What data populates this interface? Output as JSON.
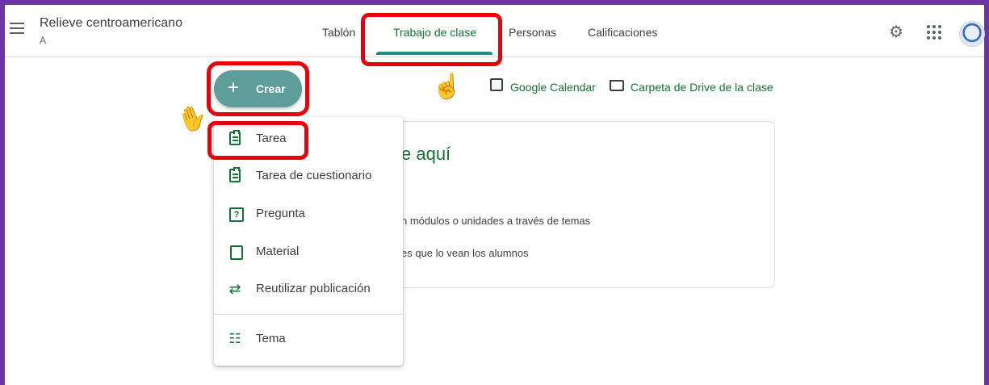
{
  "header": {
    "class_title": "Relieve centroamericano",
    "class_section": "A",
    "tabs": [
      {
        "label": "Tablón"
      },
      {
        "label": "Trabajo de clase"
      },
      {
        "label": "Personas"
      },
      {
        "label": "Calificaciones"
      }
    ]
  },
  "toolbar": {
    "create_label": "Crear",
    "create_icon": "+",
    "calendar_link": "Google Calendar",
    "drive_link": "Carpeta de Drive de la clase"
  },
  "card": {
    "title": "e aquí",
    "line1": "n módulos o unidades a través de temas",
    "line2": "es que lo vean los alumnos"
  },
  "create_menu": {
    "items": [
      {
        "label": "Tarea",
        "icon": "assignment-icon"
      },
      {
        "label": "Tarea de cuestionario",
        "icon": "quiz-assignment-icon"
      },
      {
        "label": "Pregunta",
        "icon": "question-icon"
      },
      {
        "label": "Material",
        "icon": "material-icon"
      },
      {
        "label": "Reutilizar publicación",
        "icon": "reuse-icon"
      },
      {
        "label": "Tema",
        "icon": "topic-icon"
      }
    ]
  },
  "colors": {
    "accent": "#137333",
    "create_button": "#5d9e9a",
    "highlight": "#e8000b",
    "frame": "#6a33a6",
    "pointer_hand": "#1a73e8"
  }
}
